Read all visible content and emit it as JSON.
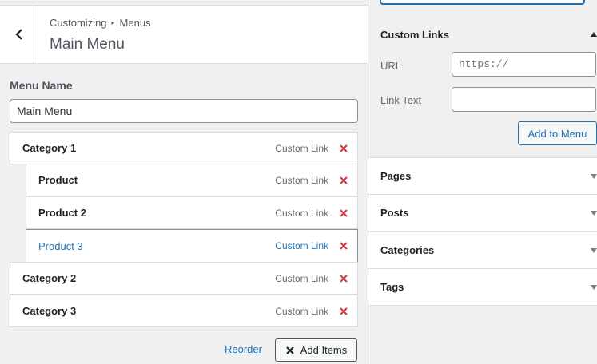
{
  "header": {
    "breadcrumb_root": "Customizing",
    "breadcrumb_current": "Menus",
    "title": "Main Menu"
  },
  "menu": {
    "name_label": "Menu Name",
    "name_value": "Main Menu",
    "items": [
      {
        "title": "Category 1",
        "type": "Custom Link",
        "depth": 0,
        "active": false
      },
      {
        "title": "Product",
        "type": "Custom Link",
        "depth": 1,
        "active": false
      },
      {
        "title": "Product 2",
        "type": "Custom Link",
        "depth": 1,
        "active": false
      },
      {
        "title": "Product 3",
        "type": "Custom Link",
        "depth": 1,
        "active": true
      },
      {
        "title": "Category 2",
        "type": "Custom Link",
        "depth": 0,
        "active": false
      },
      {
        "title": "Category 3",
        "type": "Custom Link",
        "depth": 0,
        "active": false
      }
    ],
    "reorder_label": "Reorder",
    "add_items_label": "Add Items"
  },
  "panel": {
    "custom_links": {
      "title": "Custom Links",
      "url_label": "URL",
      "url_placeholder": "https://",
      "link_text_label": "Link Text",
      "add_button": "Add to Menu"
    },
    "sections": [
      "Pages",
      "Posts",
      "Categories",
      "Tags"
    ]
  },
  "colors": {
    "accent": "#2271b1",
    "delete": "#d63638",
    "background": "#f0f0f1"
  }
}
